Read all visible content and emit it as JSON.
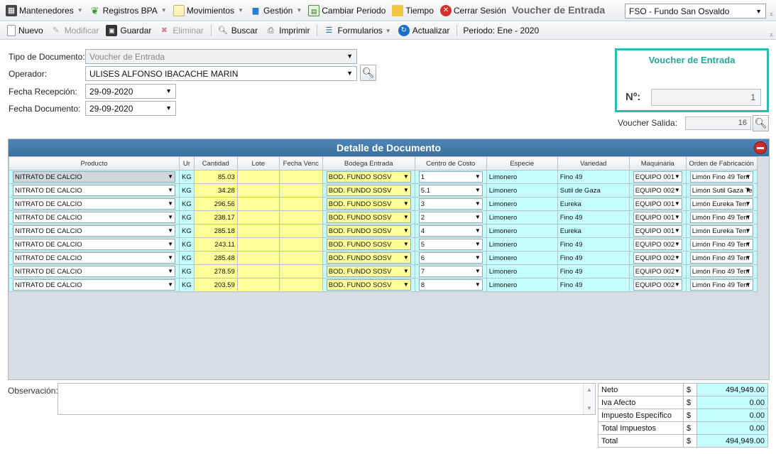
{
  "menubar": {
    "items": [
      {
        "label": "Mantenedores",
        "icon": "calculator-icon",
        "dropdown": true
      },
      {
        "label": "Registros BPA",
        "icon": "leaf-icon",
        "dropdown": true
      },
      {
        "label": "Movimientos",
        "icon": "document-icon",
        "dropdown": true
      },
      {
        "label": "Gestión",
        "icon": "chart-icon",
        "dropdown": true
      },
      {
        "label": "Cambiar Periodo",
        "icon": "calendar-icon",
        "dropdown": false
      },
      {
        "label": "Tiempo",
        "icon": "folder-icon",
        "dropdown": false
      },
      {
        "label": "Cerrar Sesión",
        "icon": "close-circle-icon",
        "dropdown": false
      }
    ],
    "app_title": "Voucher de Entrada",
    "company": "FSO - Fundo San Osvaldo"
  },
  "toolbar": {
    "nuevo": "Nuevo",
    "modificar": "Modificar",
    "guardar": "Guardar",
    "eliminar": "Eliminar",
    "buscar": "Buscar",
    "imprimir": "Imprimir",
    "formularios": "Formularios",
    "actualizar": "Actualizar",
    "periodo": "Periodo: Ene - 2020"
  },
  "form": {
    "tipo_label": "Tipo de Documento:",
    "tipo_value": "Voucher de Entrada",
    "operador_label": "Operador:",
    "operador_value": "ULISES ALFONSO IBACACHE MARIN",
    "fecha_recepcion_label": "Fecha Recepción:",
    "fecha_recepcion_value": "29-09-2020",
    "fecha_documento_label": "Fecha Documento:",
    "fecha_documento_value": "29-09-2020"
  },
  "voucher": {
    "title": "Voucher de Entrada",
    "numero_label": "Nº:",
    "numero_value": "1",
    "salida_label": "Voucher Salida:",
    "salida_value": "16"
  },
  "grid": {
    "title": "Detalle de Documento",
    "columns": [
      "Producto",
      "Ur",
      "Cantidad",
      "Lote",
      "Fecha Venc",
      "Bodega Entrada",
      "Centro de Costo",
      "Especie",
      "Variedad",
      "Maquinaria",
      "Orden de Fabricación"
    ],
    "rows": [
      {
        "producto": "NITRATO DE CALCIO",
        "ur": "KG",
        "cantidad": "85.03",
        "lote": "",
        "fecha_venc": "",
        "bodega": "BOD. FUNDO SOSV",
        "cc": "1",
        "especie": "Limonero",
        "variedad": "Fino 49",
        "maquinaria": "EQUIPO 001",
        "orden": "Limón Fino 49 Tem"
      },
      {
        "producto": "NITRATO DE CALCIO",
        "ur": "KG",
        "cantidad": "34.28",
        "lote": "",
        "fecha_venc": "",
        "bodega": "BOD. FUNDO SOSV",
        "cc": "5.1",
        "especie": "Limonero",
        "variedad": "Sutil de Gaza",
        "maquinaria": "EQUIPO 002",
        "orden": "Limón Sutil Gaza Te"
      },
      {
        "producto": "NITRATO DE CALCIO",
        "ur": "KG",
        "cantidad": "296.56",
        "lote": "",
        "fecha_venc": "",
        "bodega": "BOD. FUNDO SOSV",
        "cc": "3",
        "especie": "Limonero",
        "variedad": "Eureka",
        "maquinaria": "EQUIPO 001",
        "orden": "Limón Eureka Tem"
      },
      {
        "producto": "NITRATO DE CALCIO",
        "ur": "KG",
        "cantidad": "238.17",
        "lote": "",
        "fecha_venc": "",
        "bodega": "BOD. FUNDO SOSV",
        "cc": "2",
        "especie": "Limonero",
        "variedad": "Fino 49",
        "maquinaria": "EQUIPO 001",
        "orden": "Limón Fino 49 Tem"
      },
      {
        "producto": "NITRATO DE CALCIO",
        "ur": "KG",
        "cantidad": "285.18",
        "lote": "",
        "fecha_venc": "",
        "bodega": "BOD. FUNDO SOSV",
        "cc": "4",
        "especie": "Limonero",
        "variedad": "Eureka",
        "maquinaria": "EQUIPO 001",
        "orden": "Limón Eureka Tem"
      },
      {
        "producto": "NITRATO DE CALCIO",
        "ur": "KG",
        "cantidad": "243.11",
        "lote": "",
        "fecha_venc": "",
        "bodega": "BOD. FUNDO SOSV",
        "cc": "5",
        "especie": "Limonero",
        "variedad": "Fino 49",
        "maquinaria": "EQUIPO 002",
        "orden": "Limón Fino 49 Tem"
      },
      {
        "producto": "NITRATO DE CALCIO",
        "ur": "KG",
        "cantidad": "285.48",
        "lote": "",
        "fecha_venc": "",
        "bodega": "BOD. FUNDO SOSV",
        "cc": "6",
        "especie": "Limonero",
        "variedad": "Fino 49",
        "maquinaria": "EQUIPO 002",
        "orden": "Limón Fino 49 Tem"
      },
      {
        "producto": "NITRATO DE CALCIO",
        "ur": "KG",
        "cantidad": "278.59",
        "lote": "",
        "fecha_venc": "",
        "bodega": "BOD. FUNDO SOSV",
        "cc": "7",
        "especie": "Limonero",
        "variedad": "Fino 49",
        "maquinaria": "EQUIPO 002",
        "orden": "Limón Fino 49 Tem"
      },
      {
        "producto": "NITRATO DE CALCIO",
        "ur": "KG",
        "cantidad": "203.59",
        "lote": "",
        "fecha_venc": "",
        "bodega": "BOD. FUNDO SOSV",
        "cc": "8",
        "especie": "Limonero",
        "variedad": "Fino 49",
        "maquinaria": "EQUIPO 002",
        "orden": "Limón Fino 49 Tem"
      }
    ]
  },
  "observacion": {
    "label": "Observación:",
    "value": ""
  },
  "totals": [
    {
      "label": "Neto",
      "currency": "$",
      "value": "494,949.00"
    },
    {
      "label": "Iva Afecto",
      "currency": "$",
      "value": "0.00"
    },
    {
      "label": "Impuesto Específico",
      "currency": "$",
      "value": "0.00"
    },
    {
      "label": "Total Impuestos",
      "currency": "$",
      "value": "0.00"
    },
    {
      "label": "Total",
      "currency": "$",
      "value": "494,949.00"
    }
  ],
  "colors": {
    "accent": "#2bbbb0",
    "grid_header": "#3a6f9e",
    "editable_cell": "#ffff99",
    "readonly_cell": "#c4ffff"
  }
}
